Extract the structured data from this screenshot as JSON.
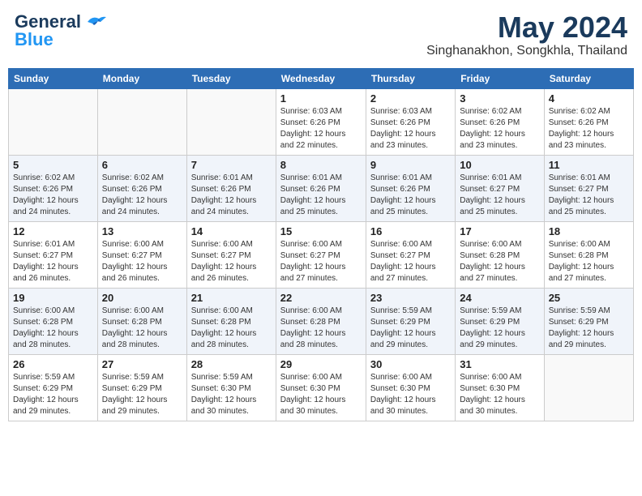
{
  "header": {
    "logo_line1": "General",
    "logo_line2": "Blue",
    "month": "May 2024",
    "location": "Singhanakhon, Songkhla, Thailand"
  },
  "weekdays": [
    "Sunday",
    "Monday",
    "Tuesday",
    "Wednesday",
    "Thursday",
    "Friday",
    "Saturday"
  ],
  "weeks": [
    [
      {
        "day": "",
        "info": ""
      },
      {
        "day": "",
        "info": ""
      },
      {
        "day": "",
        "info": ""
      },
      {
        "day": "1",
        "info": "Sunrise: 6:03 AM\nSunset: 6:26 PM\nDaylight: 12 hours\nand 22 minutes."
      },
      {
        "day": "2",
        "info": "Sunrise: 6:03 AM\nSunset: 6:26 PM\nDaylight: 12 hours\nand 23 minutes."
      },
      {
        "day": "3",
        "info": "Sunrise: 6:02 AM\nSunset: 6:26 PM\nDaylight: 12 hours\nand 23 minutes."
      },
      {
        "day": "4",
        "info": "Sunrise: 6:02 AM\nSunset: 6:26 PM\nDaylight: 12 hours\nand 23 minutes."
      }
    ],
    [
      {
        "day": "5",
        "info": "Sunrise: 6:02 AM\nSunset: 6:26 PM\nDaylight: 12 hours\nand 24 minutes."
      },
      {
        "day": "6",
        "info": "Sunrise: 6:02 AM\nSunset: 6:26 PM\nDaylight: 12 hours\nand 24 minutes."
      },
      {
        "day": "7",
        "info": "Sunrise: 6:01 AM\nSunset: 6:26 PM\nDaylight: 12 hours\nand 24 minutes."
      },
      {
        "day": "8",
        "info": "Sunrise: 6:01 AM\nSunset: 6:26 PM\nDaylight: 12 hours\nand 25 minutes."
      },
      {
        "day": "9",
        "info": "Sunrise: 6:01 AM\nSunset: 6:26 PM\nDaylight: 12 hours\nand 25 minutes."
      },
      {
        "day": "10",
        "info": "Sunrise: 6:01 AM\nSunset: 6:27 PM\nDaylight: 12 hours\nand 25 minutes."
      },
      {
        "day": "11",
        "info": "Sunrise: 6:01 AM\nSunset: 6:27 PM\nDaylight: 12 hours\nand 25 minutes."
      }
    ],
    [
      {
        "day": "12",
        "info": "Sunrise: 6:01 AM\nSunset: 6:27 PM\nDaylight: 12 hours\nand 26 minutes."
      },
      {
        "day": "13",
        "info": "Sunrise: 6:00 AM\nSunset: 6:27 PM\nDaylight: 12 hours\nand 26 minutes."
      },
      {
        "day": "14",
        "info": "Sunrise: 6:00 AM\nSunset: 6:27 PM\nDaylight: 12 hours\nand 26 minutes."
      },
      {
        "day": "15",
        "info": "Sunrise: 6:00 AM\nSunset: 6:27 PM\nDaylight: 12 hours\nand 27 minutes."
      },
      {
        "day": "16",
        "info": "Sunrise: 6:00 AM\nSunset: 6:27 PM\nDaylight: 12 hours\nand 27 minutes."
      },
      {
        "day": "17",
        "info": "Sunrise: 6:00 AM\nSunset: 6:28 PM\nDaylight: 12 hours\nand 27 minutes."
      },
      {
        "day": "18",
        "info": "Sunrise: 6:00 AM\nSunset: 6:28 PM\nDaylight: 12 hours\nand 27 minutes."
      }
    ],
    [
      {
        "day": "19",
        "info": "Sunrise: 6:00 AM\nSunset: 6:28 PM\nDaylight: 12 hours\nand 28 minutes."
      },
      {
        "day": "20",
        "info": "Sunrise: 6:00 AM\nSunset: 6:28 PM\nDaylight: 12 hours\nand 28 minutes."
      },
      {
        "day": "21",
        "info": "Sunrise: 6:00 AM\nSunset: 6:28 PM\nDaylight: 12 hours\nand 28 minutes."
      },
      {
        "day": "22",
        "info": "Sunrise: 6:00 AM\nSunset: 6:28 PM\nDaylight: 12 hours\nand 28 minutes."
      },
      {
        "day": "23",
        "info": "Sunrise: 5:59 AM\nSunset: 6:29 PM\nDaylight: 12 hours\nand 29 minutes."
      },
      {
        "day": "24",
        "info": "Sunrise: 5:59 AM\nSunset: 6:29 PM\nDaylight: 12 hours\nand 29 minutes."
      },
      {
        "day": "25",
        "info": "Sunrise: 5:59 AM\nSunset: 6:29 PM\nDaylight: 12 hours\nand 29 minutes."
      }
    ],
    [
      {
        "day": "26",
        "info": "Sunrise: 5:59 AM\nSunset: 6:29 PM\nDaylight: 12 hours\nand 29 minutes."
      },
      {
        "day": "27",
        "info": "Sunrise: 5:59 AM\nSunset: 6:29 PM\nDaylight: 12 hours\nand 29 minutes."
      },
      {
        "day": "28",
        "info": "Sunrise: 5:59 AM\nSunset: 6:30 PM\nDaylight: 12 hours\nand 30 minutes."
      },
      {
        "day": "29",
        "info": "Sunrise: 6:00 AM\nSunset: 6:30 PM\nDaylight: 12 hours\nand 30 minutes."
      },
      {
        "day": "30",
        "info": "Sunrise: 6:00 AM\nSunset: 6:30 PM\nDaylight: 12 hours\nand 30 minutes."
      },
      {
        "day": "31",
        "info": "Sunrise: 6:00 AM\nSunset: 6:30 PM\nDaylight: 12 hours\nand 30 minutes."
      },
      {
        "day": "",
        "info": ""
      }
    ]
  ]
}
